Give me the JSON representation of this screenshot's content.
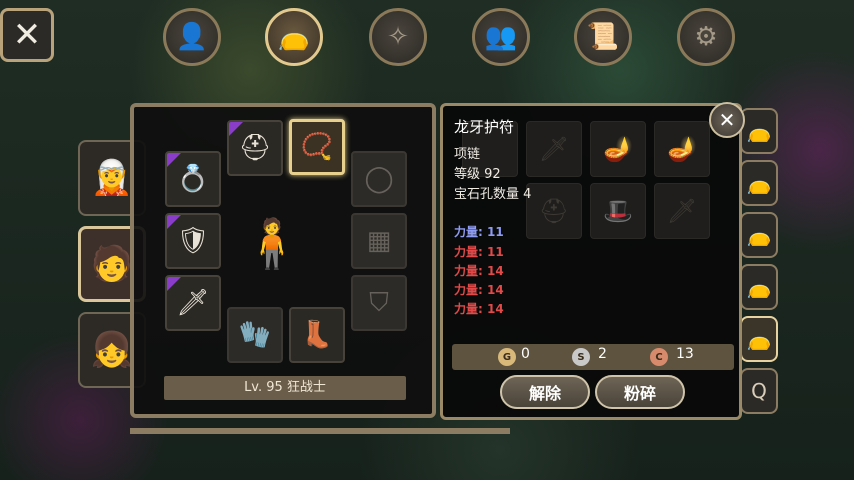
{
  "top_nav": {
    "close_icon": "close-icon",
    "tabs": [
      {
        "icon": "head-profile-icon",
        "glyph": "👤",
        "active": false
      },
      {
        "icon": "bag-icon",
        "glyph": "👝",
        "active": true
      },
      {
        "icon": "compass-icon",
        "glyph": "✧",
        "active": false
      },
      {
        "icon": "party-icon",
        "glyph": "👥",
        "active": false
      },
      {
        "icon": "scroll-icon",
        "glyph": "📜",
        "active": false
      },
      {
        "icon": "gear-icon",
        "glyph": "⚙",
        "active": false
      }
    ]
  },
  "characters": [
    {
      "name": "silver-haired-hero",
      "glyph": "🧝",
      "active": false
    },
    {
      "name": "red-haired-warrior",
      "glyph": "🧑",
      "active": true
    },
    {
      "name": "blonde-girl",
      "glyph": "👧",
      "active": false
    }
  ],
  "equipment": {
    "level_label": "Lv. 95 狂战士",
    "slots": [
      {
        "name": "helmet",
        "glyph": "⛑",
        "filled": true,
        "rare": true
      },
      {
        "name": "necklace",
        "glyph": "📿",
        "filled": true,
        "selected": true
      },
      {
        "name": "earring",
        "glyph": "💍",
        "filled": true,
        "rare": true
      },
      {
        "name": "armor",
        "glyph": "🛡",
        "filled": true,
        "rare": true
      },
      {
        "name": "weapon",
        "glyph": "🗡",
        "filled": true,
        "rare": true
      },
      {
        "name": "gloves",
        "glyph": "🧤",
        "filled": false
      },
      {
        "name": "boots",
        "glyph": "👢",
        "filled": true
      },
      {
        "name": "ring",
        "glyph": "◯",
        "filled": false
      },
      {
        "name": "cloak",
        "glyph": "▦",
        "filled": false
      },
      {
        "name": "shield",
        "glyph": "⛉",
        "filled": false
      }
    ],
    "figure_glyph": "🧍"
  },
  "item_detail": {
    "name": "龙牙护符",
    "type": "项链",
    "level": "等级 92",
    "sockets": "宝石孔数量 4",
    "stats": [
      {
        "text": "力量: 11",
        "color": "#8f9cf2"
      },
      {
        "text": "力量: 11",
        "color": "#e24a4a"
      },
      {
        "text": "力量: 14",
        "color": "#e24a4a"
      },
      {
        "text": "力量: 14",
        "color": "#e24a4a"
      },
      {
        "text": "力量: 14",
        "color": "#e24a4a"
      }
    ],
    "currency": {
      "gold": "0",
      "silver": "2",
      "copper": "13"
    },
    "buttons": {
      "unequip": "解除",
      "smash": "粉碎"
    }
  },
  "side_tabs": {
    "last_label": "Q"
  }
}
